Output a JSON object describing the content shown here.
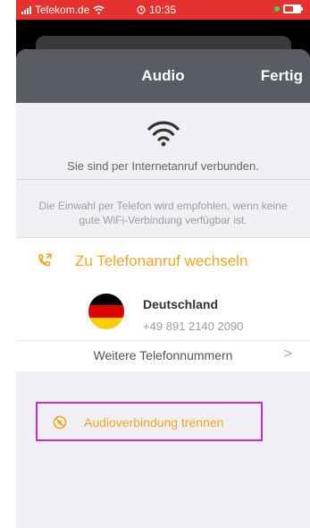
{
  "status_bar": {
    "carrier": "Telekom.de",
    "time": "10:35",
    "colors": {
      "bar": "#e5312f",
      "dot": "#3ed15a"
    },
    "icons": [
      "signal-icon",
      "wifi-icon",
      "clock-icon",
      "battery-icon"
    ]
  },
  "nav": {
    "title": "Audio",
    "done_label": "Fertig"
  },
  "wifi_section": {
    "icon": "wifi-icon",
    "connected_text": "Sie sind per Internetanruf verbunden.",
    "hint_text": "Die Einwahl per Telefon wird empfohlen, wenn keine gute WiFi-Verbindung verfügbar ist."
  },
  "switch_call": {
    "icon": "phone-switch-icon",
    "label": "Zu Telefonanruf wechseln"
  },
  "country": {
    "name": "Deutschland",
    "number": "+49 891 2140 2090",
    "flag_colors": [
      "#000000",
      "#dd0000",
      "#ffce00"
    ]
  },
  "more_numbers": {
    "label": "Weitere Telefonnummern",
    "chevron": ">"
  },
  "disconnect": {
    "icon": "no-audio-icon",
    "label": "Audioverbindung trennen",
    "highlight_color": "#c72bd6"
  },
  "accent_color": "#f5a623"
}
